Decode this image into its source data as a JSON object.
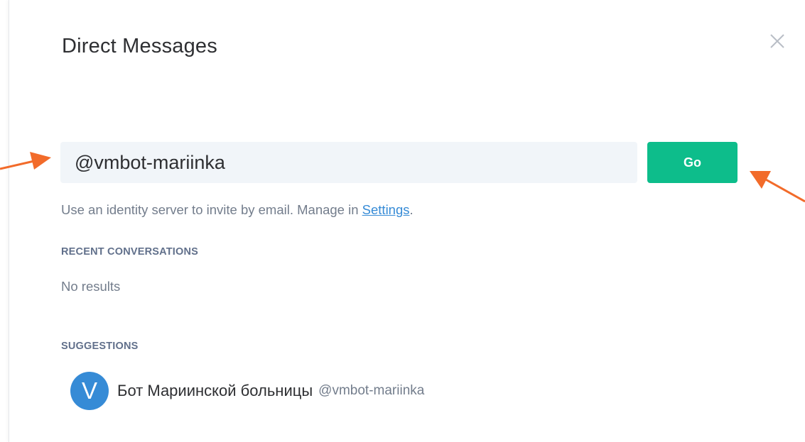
{
  "dialog": {
    "title": "Direct Messages",
    "close_icon": "close-icon"
  },
  "search": {
    "value": "@vmbot-mariinka",
    "go_label": "Go"
  },
  "hint": {
    "text_before": "Use an identity server to invite by email. Manage in ",
    "link_text": "Settings",
    "text_after": "."
  },
  "recent": {
    "label": "RECENT CONVERSATIONS",
    "empty_text": "No results"
  },
  "suggestions": {
    "label": "SUGGESTIONS",
    "items": [
      {
        "avatar_letter": "V",
        "name": "Бот Мариинской больницы",
        "user_id": "@vmbot-mariinka"
      }
    ]
  },
  "colors": {
    "accent_green": "#0dbd8b",
    "avatar_blue": "#368bd6",
    "link_blue": "#368bd6",
    "annotation_arrow": "#f26b2a"
  }
}
